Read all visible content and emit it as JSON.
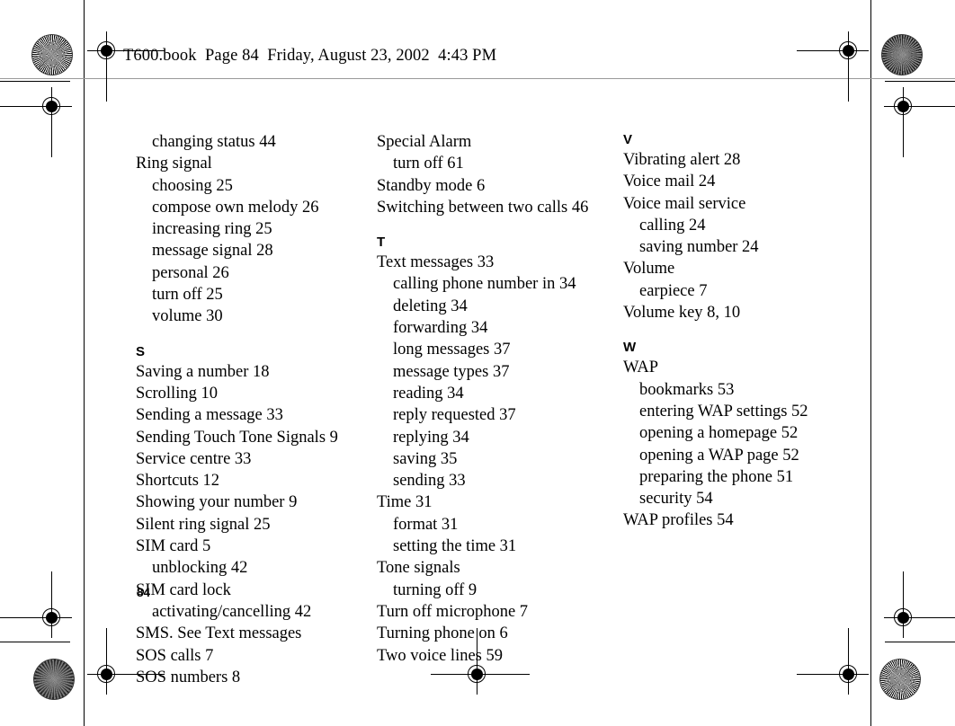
{
  "header": {
    "file_line": "T600.book  Page 84  Friday, August 23, 2002  4:43 PM"
  },
  "folio": {
    "page_number": "84"
  },
  "index": {
    "columns": [
      {
        "id": "column-1",
        "blocks": [
          {
            "letter": null,
            "entries": [
              {
                "text": "changing status 44",
                "level": "sub"
              },
              {
                "text": "Ring signal",
                "level": "main"
              },
              {
                "text": "choosing 25",
                "level": "sub"
              },
              {
                "text": "compose own melody 26",
                "level": "sub"
              },
              {
                "text": "increasing ring 25",
                "level": "sub"
              },
              {
                "text": "message signal 28",
                "level": "sub"
              },
              {
                "text": "personal 26",
                "level": "sub"
              },
              {
                "text": "turn off 25",
                "level": "sub"
              },
              {
                "text": "volume 30",
                "level": "sub"
              }
            ]
          },
          {
            "letter": "S",
            "entries": [
              {
                "text": "Saving a number 18",
                "level": "main"
              },
              {
                "text": "Scrolling 10",
                "level": "main"
              },
              {
                "text": "Sending a message 33",
                "level": "main"
              },
              {
                "text": "Sending Touch Tone Signals 9",
                "level": "main"
              },
              {
                "text": "Service centre 33",
                "level": "main"
              },
              {
                "text": "Shortcuts 12",
                "level": "main"
              },
              {
                "text": "Showing your number 9",
                "level": "main"
              },
              {
                "text": "Silent ring signal 25",
                "level": "main"
              },
              {
                "text": "SIM card 5",
                "level": "main"
              },
              {
                "text": "unblocking 42",
                "level": "sub"
              },
              {
                "text": "SIM card lock",
                "level": "main"
              },
              {
                "text": "activating/cancelling 42",
                "level": "sub"
              },
              {
                "text": "SMS. See Text messages",
                "level": "main"
              },
              {
                "text": "SOS calls 7",
                "level": "main"
              },
              {
                "text": "SOS numbers 8",
                "level": "main"
              }
            ]
          }
        ]
      },
      {
        "id": "column-2",
        "blocks": [
          {
            "letter": null,
            "entries": [
              {
                "text": "Special Alarm",
                "level": "main"
              },
              {
                "text": "turn off 61",
                "level": "sub"
              },
              {
                "text": "Standby mode 6",
                "level": "main"
              },
              {
                "text": "Switching between two calls 46",
                "level": "main"
              }
            ]
          },
          {
            "letter": "T",
            "entries": [
              {
                "text": "Text messages 33",
                "level": "main"
              },
              {
                "text": "calling phone number in 34",
                "level": "sub"
              },
              {
                "text": "deleting 34",
                "level": "sub"
              },
              {
                "text": "forwarding 34",
                "level": "sub"
              },
              {
                "text": "long messages 37",
                "level": "sub"
              },
              {
                "text": "message types 37",
                "level": "sub"
              },
              {
                "text": "reading 34",
                "level": "sub"
              },
              {
                "text": "reply requested 37",
                "level": "sub"
              },
              {
                "text": "replying 34",
                "level": "sub"
              },
              {
                "text": "saving 35",
                "level": "sub"
              },
              {
                "text": "sending 33",
                "level": "sub"
              },
              {
                "text": "Time 31",
                "level": "main"
              },
              {
                "text": "format 31",
                "level": "sub"
              },
              {
                "text": "setting the time 31",
                "level": "sub"
              },
              {
                "text": "Tone signals",
                "level": "main"
              },
              {
                "text": "turning off 9",
                "level": "sub"
              },
              {
                "text": "Turn off microphone 7",
                "level": "main"
              },
              {
                "text": "Turning phone on 6",
                "level": "main"
              },
              {
                "text": "Two voice lines 59",
                "level": "main"
              }
            ]
          }
        ]
      },
      {
        "id": "column-3",
        "blocks": [
          {
            "letter": "V",
            "entries": [
              {
                "text": "Vibrating alert 28",
                "level": "main"
              },
              {
                "text": "Voice mail 24",
                "level": "main"
              },
              {
                "text": "Voice mail service",
                "level": "main"
              },
              {
                "text": "calling 24",
                "level": "sub"
              },
              {
                "text": "saving number 24",
                "level": "sub"
              },
              {
                "text": "Volume",
                "level": "main"
              },
              {
                "text": "earpiece 7",
                "level": "sub"
              },
              {
                "text": "Volume key 8, 10",
                "level": "main"
              }
            ]
          },
          {
            "letter": "W",
            "entries": [
              {
                "text": "WAP",
                "level": "main"
              },
              {
                "text": "bookmarks 53",
                "level": "sub"
              },
              {
                "text": "entering WAP settings 52",
                "level": "sub"
              },
              {
                "text": "opening a homepage 52",
                "level": "sub"
              },
              {
                "text": "opening a WAP page 52",
                "level": "sub"
              },
              {
                "text": "preparing the phone 51",
                "level": "sub"
              },
              {
                "text": "security 54",
                "level": "sub"
              },
              {
                "text": "WAP profiles 54",
                "level": "main"
              }
            ]
          }
        ]
      }
    ]
  }
}
